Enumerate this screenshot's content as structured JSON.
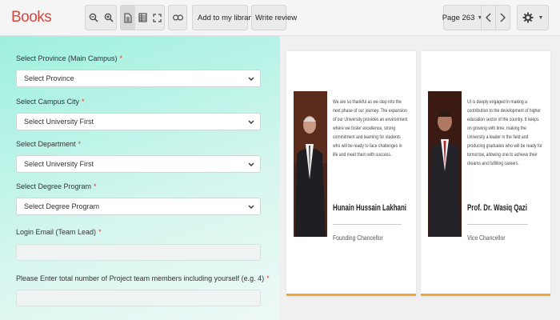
{
  "toolbar": {
    "title": "Books",
    "add_to_library": "Add to my library",
    "write_review": "Write review",
    "page_indicator": "Page 263"
  },
  "icons": [
    "zoom-out-icon",
    "zoom-in-icon",
    "single-page-icon",
    "text-view-icon",
    "fullscreen-icon",
    "link-icon",
    "chevron-left-icon",
    "chevron-right-icon",
    "gear-icon"
  ],
  "form": {
    "province_label": "Select Province (Main Campus)",
    "province_value": "Select Province",
    "city_label": "Select Campus City",
    "city_value": "Select University First",
    "department_label": "Select Department",
    "department_value": "Select University First",
    "degree_label": "Select Degree Program",
    "degree_value": "Select Degree Program",
    "email_label": "Login Email (Team Lead)",
    "members_label": "Please Enter total number of Project team members including yourself (e.g. 4)",
    "required_mark": "*"
  },
  "book": {
    "left_page": {
      "quote": "We are so thankful as we step into the next phase of our journey. The expansion of our University provides an environment where we foster excellence, strong commitment and learning for students who will be ready to face challenges in life and meet them with success.",
      "name": "Hunain Hussain Lakhani",
      "role": "Founding Chancellor"
    },
    "right_page": {
      "quote": "UI is deeply engaged in making a contribution to the development of higher education sector of the country. It keeps on growing with time, making the University a leader in the field and producing graduates who will be ready for tomorrow, allowing one to achieve their dreams and fulfilling careers.",
      "name": "Prof. Dr. Wasiq Qazi",
      "role": "Vice Chancellor"
    }
  },
  "colors": {
    "brand": "#d5483d",
    "required": "#e53935",
    "page_accent": "#f0a730",
    "form_gradient_start": "#9ff0de"
  }
}
